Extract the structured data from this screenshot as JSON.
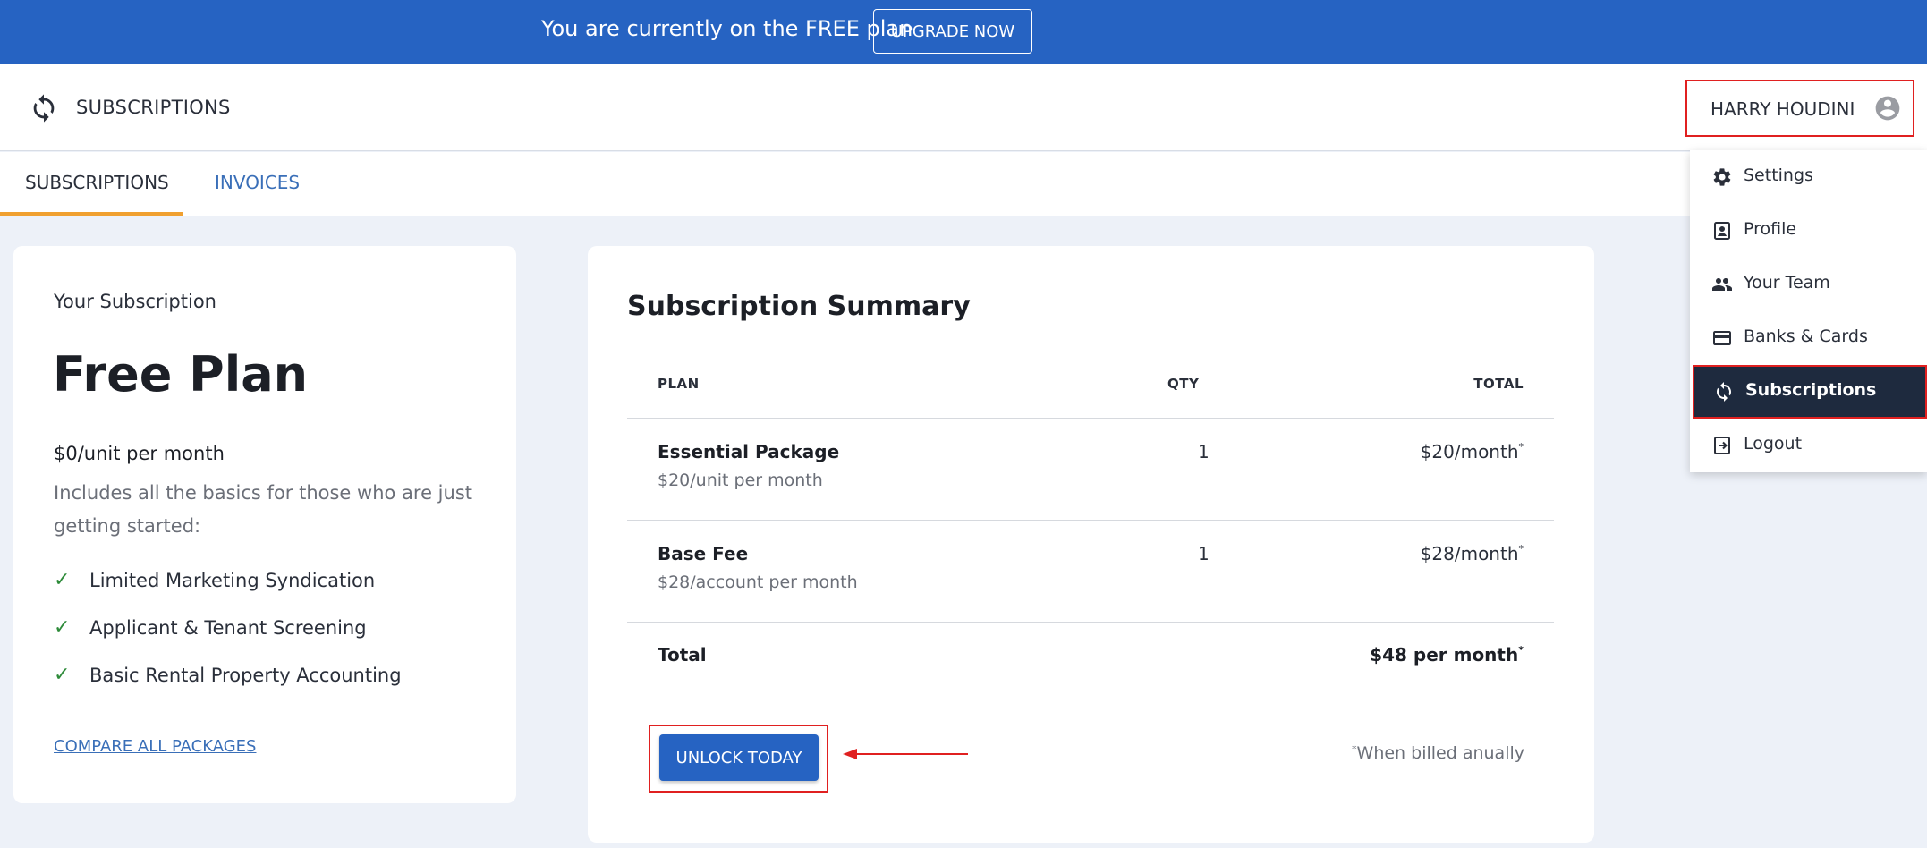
{
  "banner": {
    "text": "You are currently on the FREE plan",
    "upgrade_label": "UPGRADE NOW"
  },
  "header": {
    "title": "SUBSCRIPTIONS",
    "icon": "sync-icon",
    "user_name": "HARRY HOUDINI"
  },
  "tabs": [
    {
      "label": "SUBSCRIPTIONS",
      "active": true
    },
    {
      "label": "INVOICES",
      "active": false
    }
  ],
  "current_plan": {
    "heading": "Your Subscription",
    "name": "Free Plan",
    "price": "$0/unit per month",
    "description": "Includes all the basics for those who are just getting started:",
    "features": [
      "Limited Marketing Syndication",
      "Applicant & Tenant Screening",
      "Basic Rental Property Accounting"
    ],
    "compare_link": "COMPARE ALL PACKAGES"
  },
  "summary": {
    "title": "Subscription Summary",
    "columns": {
      "plan": "PLAN",
      "qty": "QTY",
      "total": "TOTAL"
    },
    "rows": [
      {
        "name": "Essential Package",
        "sub": "$20/unit per month",
        "qty": "1",
        "total": "$20/month"
      },
      {
        "name": "Base Fee",
        "sub": "$28/account per month",
        "qty": "1",
        "total": "$28/month"
      }
    ],
    "total_label": "Total",
    "total_value": "$48 per month",
    "asterisk": "*",
    "unlock_label": "UNLOCK TODAY",
    "note": "When billed anually"
  },
  "menu": {
    "items": [
      {
        "label": "Settings",
        "icon": "gear-icon"
      },
      {
        "label": "Profile",
        "icon": "profile-icon"
      },
      {
        "label": "Your Team",
        "icon": "team-icon"
      },
      {
        "label": "Banks & Cards",
        "icon": "card-icon"
      },
      {
        "label": "Subscriptions",
        "icon": "sync-icon",
        "active": true
      },
      {
        "label": "Logout",
        "icon": "logout-icon"
      }
    ]
  },
  "colors": {
    "brand": "#2663c2",
    "highlight": "#e02020",
    "tab_accent": "#f0a030",
    "menu_active": "#1e2a3e"
  }
}
